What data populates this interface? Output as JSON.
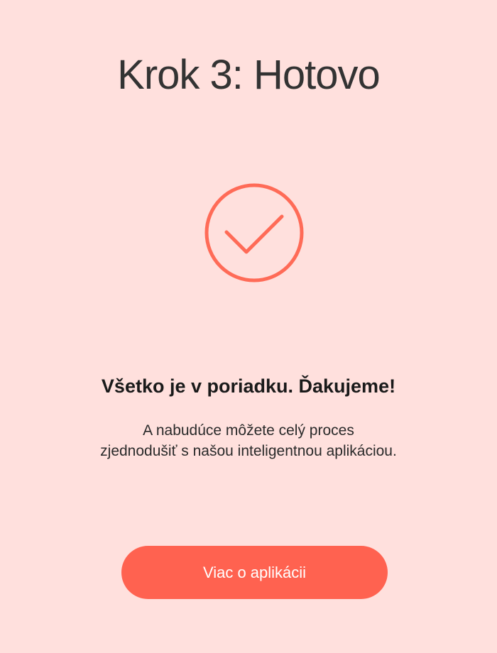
{
  "header": {
    "title": "Krok 3: Hotovo"
  },
  "status": {
    "icon": "check-circle-icon",
    "icon_color": "#FF6B57"
  },
  "message": {
    "headline": "Všetko je v poriadku. Ďakujeme!",
    "description_line1": "A nabudúce môžete celý proces",
    "description_line2": "zjednodušiť s našou inteligentnou aplikáciou."
  },
  "cta": {
    "label": "Viac o aplikácii",
    "color": "#FF6250"
  },
  "colors": {
    "background": "#FFE0DD",
    "title": "#333333",
    "text": "#1A1A1A"
  }
}
